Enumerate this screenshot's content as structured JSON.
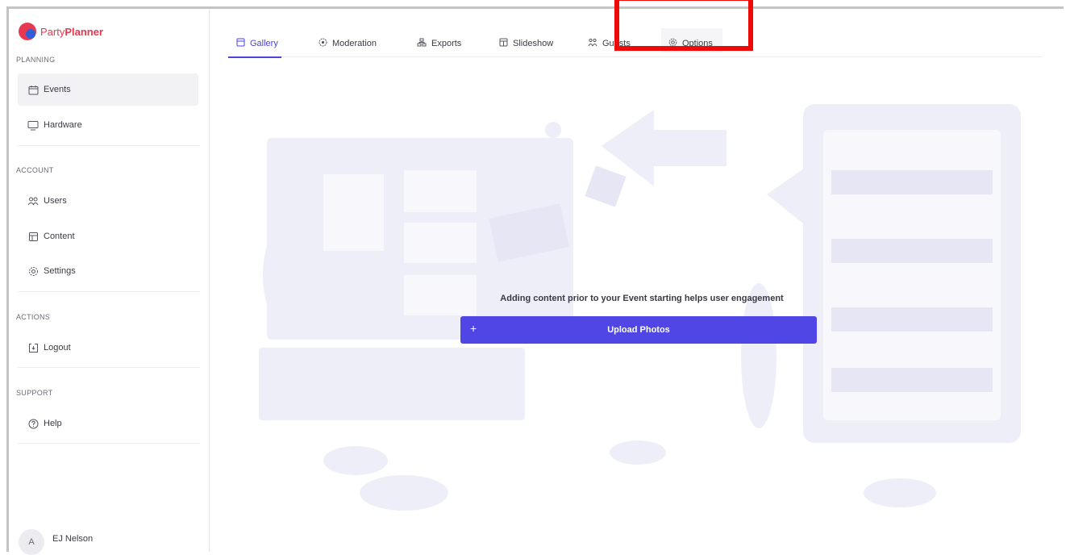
{
  "brand": {
    "name_part1": "Party",
    "name_part2": "Planner",
    "color": "#e8384f"
  },
  "sidebar": {
    "sections": [
      {
        "label": "PLANNING"
      },
      {
        "label": "ACCOUNT"
      },
      {
        "label": "ACTIONS"
      },
      {
        "label": "SUPPORT"
      }
    ],
    "items": [
      {
        "label": "Events",
        "icon": "calendar-icon",
        "active": true
      },
      {
        "label": "Hardware",
        "icon": "monitor-icon"
      },
      {
        "label": "Users",
        "icon": "users-icon"
      },
      {
        "label": "Content",
        "icon": "content-icon"
      },
      {
        "label": "Settings",
        "icon": "gear-icon"
      },
      {
        "label": "Logout",
        "icon": "logout-icon"
      },
      {
        "label": "Help",
        "icon": "help-icon"
      }
    ]
  },
  "user": {
    "initial": "A",
    "name": "EJ Nelson"
  },
  "tabs": [
    {
      "label": "Gallery",
      "icon": "gallery-icon",
      "active": true
    },
    {
      "label": "Moderation",
      "icon": "moderation-icon"
    },
    {
      "label": "Exports",
      "icon": "exports-icon"
    },
    {
      "label": "Slideshow",
      "icon": "slideshow-icon"
    },
    {
      "label": "Guests",
      "icon": "guests-icon"
    },
    {
      "label": "Options",
      "icon": "gear-icon"
    }
  ],
  "main": {
    "message": "Adding content prior to your Event starting helps user engagement",
    "upload_label": "Upload Photos",
    "upload_icon": "plus-icon"
  },
  "colors": {
    "accent": "#4f46e5",
    "highlight": "#ef0a0a"
  }
}
